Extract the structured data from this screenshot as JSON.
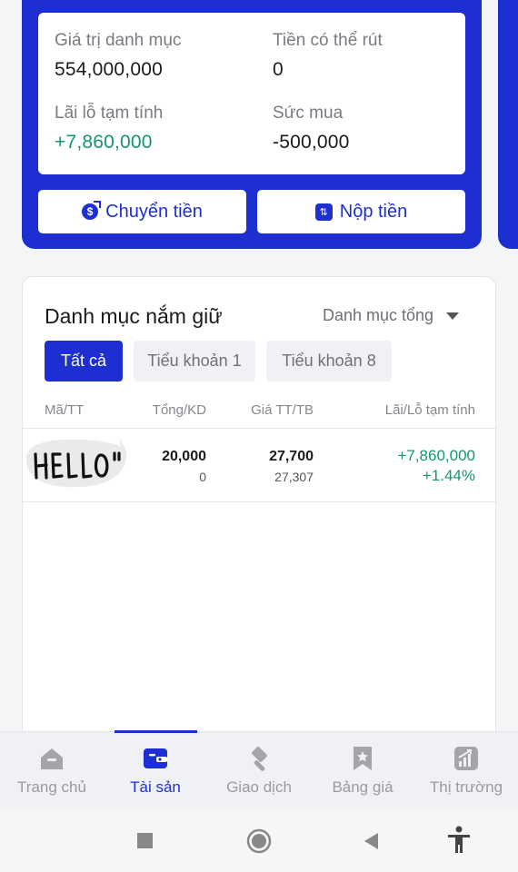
{
  "summary": {
    "portfolio_value_label": "Giá trị danh mục",
    "portfolio_value": "554,000,000",
    "withdrawable_label": "Tiền có thể rút",
    "withdrawable": "0",
    "pnl_label": "Lãi lỗ tạm tính",
    "pnl": "+7,860,000",
    "buying_power_label": "Sức mua",
    "buying_power": "-500,000",
    "transfer_button": "Chuyển tiền",
    "deposit_button": "Nộp tiền"
  },
  "holdings": {
    "title": "Danh mục nắm giữ",
    "filter": "Danh mục tổng",
    "tabs": [
      "Tất cả",
      "Tiểu khoản 1",
      "Tiểu khoản 8"
    ],
    "columns": [
      "Mã/TT",
      "Tổng/KD",
      "Giá TT/TB",
      "Lãi/Lỗ tạm tính"
    ],
    "rows": [
      {
        "sticker_text": "HELLO\"",
        "total": "20,000",
        "available": "0",
        "market_price": "27,700",
        "avg_price": "27,307",
        "pnl_value": "+7,860,000",
        "pnl_percent": "+1.44%"
      }
    ]
  },
  "bottom_nav": {
    "items": [
      {
        "label": "Trang chủ",
        "icon": "home-icon"
      },
      {
        "label": "Tài sản",
        "icon": "wallet-icon"
      },
      {
        "label": "Giao dịch",
        "icon": "gavel-icon"
      },
      {
        "label": "Bảng giá",
        "icon": "bookmark-icon"
      },
      {
        "label": "Thị trường",
        "icon": "chart-icon"
      }
    ],
    "active": "Tài sản"
  },
  "system_nav": [
    "recent-apps-icon",
    "home-circle-icon",
    "back-icon",
    "accessibility-icon"
  ],
  "colors": {
    "brand_blue": "#1d2fd1",
    "positive_green": "#14976a"
  }
}
